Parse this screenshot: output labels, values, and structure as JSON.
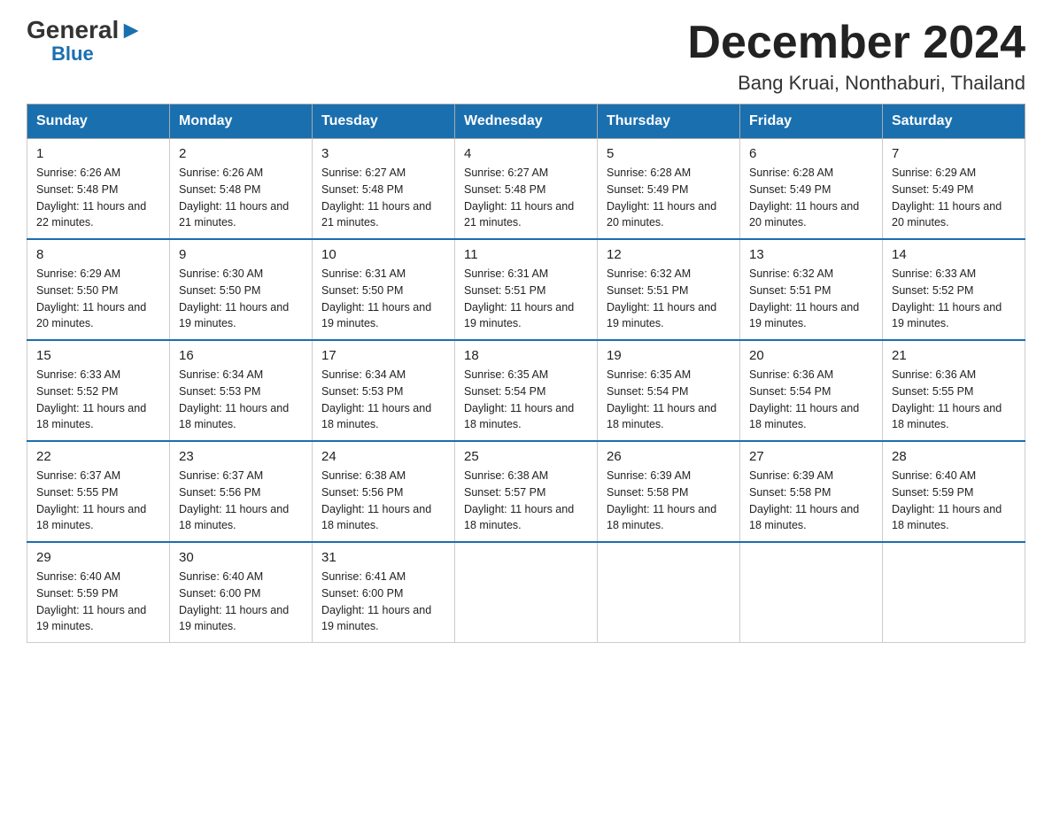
{
  "logo": {
    "general": "General",
    "blue": "Blue",
    "triangle": "▶"
  },
  "header": {
    "month_title": "December 2024",
    "location": "Bang Kruai, Nonthaburi, Thailand"
  },
  "columns": [
    "Sunday",
    "Monday",
    "Tuesday",
    "Wednesday",
    "Thursday",
    "Friday",
    "Saturday"
  ],
  "weeks": [
    [
      {
        "day": "1",
        "sunrise": "6:26 AM",
        "sunset": "5:48 PM",
        "daylight": "11 hours and 22 minutes."
      },
      {
        "day": "2",
        "sunrise": "6:26 AM",
        "sunset": "5:48 PM",
        "daylight": "11 hours and 21 minutes."
      },
      {
        "day": "3",
        "sunrise": "6:27 AM",
        "sunset": "5:48 PM",
        "daylight": "11 hours and 21 minutes."
      },
      {
        "day": "4",
        "sunrise": "6:27 AM",
        "sunset": "5:48 PM",
        "daylight": "11 hours and 21 minutes."
      },
      {
        "day": "5",
        "sunrise": "6:28 AM",
        "sunset": "5:49 PM",
        "daylight": "11 hours and 20 minutes."
      },
      {
        "day": "6",
        "sunrise": "6:28 AM",
        "sunset": "5:49 PM",
        "daylight": "11 hours and 20 minutes."
      },
      {
        "day": "7",
        "sunrise": "6:29 AM",
        "sunset": "5:49 PM",
        "daylight": "11 hours and 20 minutes."
      }
    ],
    [
      {
        "day": "8",
        "sunrise": "6:29 AM",
        "sunset": "5:50 PM",
        "daylight": "11 hours and 20 minutes."
      },
      {
        "day": "9",
        "sunrise": "6:30 AM",
        "sunset": "5:50 PM",
        "daylight": "11 hours and 19 minutes."
      },
      {
        "day": "10",
        "sunrise": "6:31 AM",
        "sunset": "5:50 PM",
        "daylight": "11 hours and 19 minutes."
      },
      {
        "day": "11",
        "sunrise": "6:31 AM",
        "sunset": "5:51 PM",
        "daylight": "11 hours and 19 minutes."
      },
      {
        "day": "12",
        "sunrise": "6:32 AM",
        "sunset": "5:51 PM",
        "daylight": "11 hours and 19 minutes."
      },
      {
        "day": "13",
        "sunrise": "6:32 AM",
        "sunset": "5:51 PM",
        "daylight": "11 hours and 19 minutes."
      },
      {
        "day": "14",
        "sunrise": "6:33 AM",
        "sunset": "5:52 PM",
        "daylight": "11 hours and 19 minutes."
      }
    ],
    [
      {
        "day": "15",
        "sunrise": "6:33 AM",
        "sunset": "5:52 PM",
        "daylight": "11 hours and 18 minutes."
      },
      {
        "day": "16",
        "sunrise": "6:34 AM",
        "sunset": "5:53 PM",
        "daylight": "11 hours and 18 minutes."
      },
      {
        "day": "17",
        "sunrise": "6:34 AM",
        "sunset": "5:53 PM",
        "daylight": "11 hours and 18 minutes."
      },
      {
        "day": "18",
        "sunrise": "6:35 AM",
        "sunset": "5:54 PM",
        "daylight": "11 hours and 18 minutes."
      },
      {
        "day": "19",
        "sunrise": "6:35 AM",
        "sunset": "5:54 PM",
        "daylight": "11 hours and 18 minutes."
      },
      {
        "day": "20",
        "sunrise": "6:36 AM",
        "sunset": "5:54 PM",
        "daylight": "11 hours and 18 minutes."
      },
      {
        "day": "21",
        "sunrise": "6:36 AM",
        "sunset": "5:55 PM",
        "daylight": "11 hours and 18 minutes."
      }
    ],
    [
      {
        "day": "22",
        "sunrise": "6:37 AM",
        "sunset": "5:55 PM",
        "daylight": "11 hours and 18 minutes."
      },
      {
        "day": "23",
        "sunrise": "6:37 AM",
        "sunset": "5:56 PM",
        "daylight": "11 hours and 18 minutes."
      },
      {
        "day": "24",
        "sunrise": "6:38 AM",
        "sunset": "5:56 PM",
        "daylight": "11 hours and 18 minutes."
      },
      {
        "day": "25",
        "sunrise": "6:38 AM",
        "sunset": "5:57 PM",
        "daylight": "11 hours and 18 minutes."
      },
      {
        "day": "26",
        "sunrise": "6:39 AM",
        "sunset": "5:58 PM",
        "daylight": "11 hours and 18 minutes."
      },
      {
        "day": "27",
        "sunrise": "6:39 AM",
        "sunset": "5:58 PM",
        "daylight": "11 hours and 18 minutes."
      },
      {
        "day": "28",
        "sunrise": "6:40 AM",
        "sunset": "5:59 PM",
        "daylight": "11 hours and 18 minutes."
      }
    ],
    [
      {
        "day": "29",
        "sunrise": "6:40 AM",
        "sunset": "5:59 PM",
        "daylight": "11 hours and 19 minutes."
      },
      {
        "day": "30",
        "sunrise": "6:40 AM",
        "sunset": "6:00 PM",
        "daylight": "11 hours and 19 minutes."
      },
      {
        "day": "31",
        "sunrise": "6:41 AM",
        "sunset": "6:00 PM",
        "daylight": "11 hours and 19 minutes."
      },
      null,
      null,
      null,
      null
    ]
  ]
}
